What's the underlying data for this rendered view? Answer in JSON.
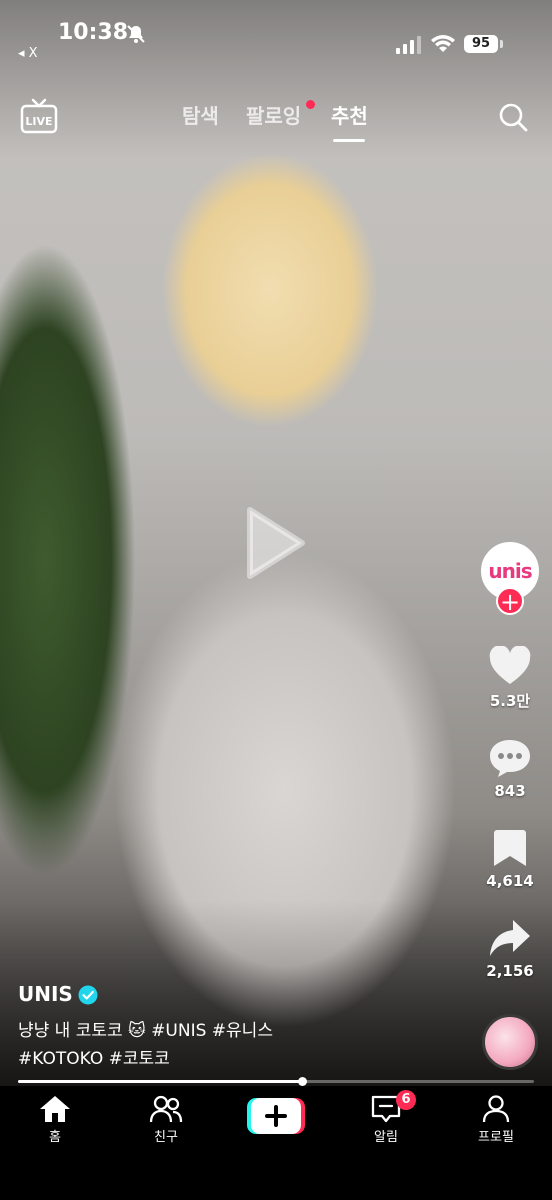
{
  "status_bar": {
    "time": "10:38",
    "back_label": "◂ X",
    "battery": "95"
  },
  "top_nav": {
    "tabs": [
      {
        "label": "탐색"
      },
      {
        "label": "팔로잉"
      },
      {
        "label": "추천"
      }
    ],
    "active_tab": "추천",
    "live_label": "LIVE"
  },
  "creator": {
    "avatar_text": "unis",
    "follow_label": "+"
  },
  "actions": {
    "likes": "5.3만",
    "comments": "843",
    "saves": "4,614",
    "shares": "2,156"
  },
  "post": {
    "author": "UNIS",
    "caption_line1": "냥냥 내 코토코 🐱 #UNIS #유니스",
    "caption_line2": "#KOTOKO #코토코",
    "progress": 0.55
  },
  "bottom_nav": {
    "items": [
      {
        "label": "홈"
      },
      {
        "label": "친구"
      },
      {
        "label": ""
      },
      {
        "label": "알림"
      },
      {
        "label": "프로필"
      }
    ],
    "inbox_badge": "6"
  },
  "colors": {
    "accent": "#fe2c55",
    "verified": "#20d5ec",
    "brand_cyan": "#25f4ee"
  }
}
